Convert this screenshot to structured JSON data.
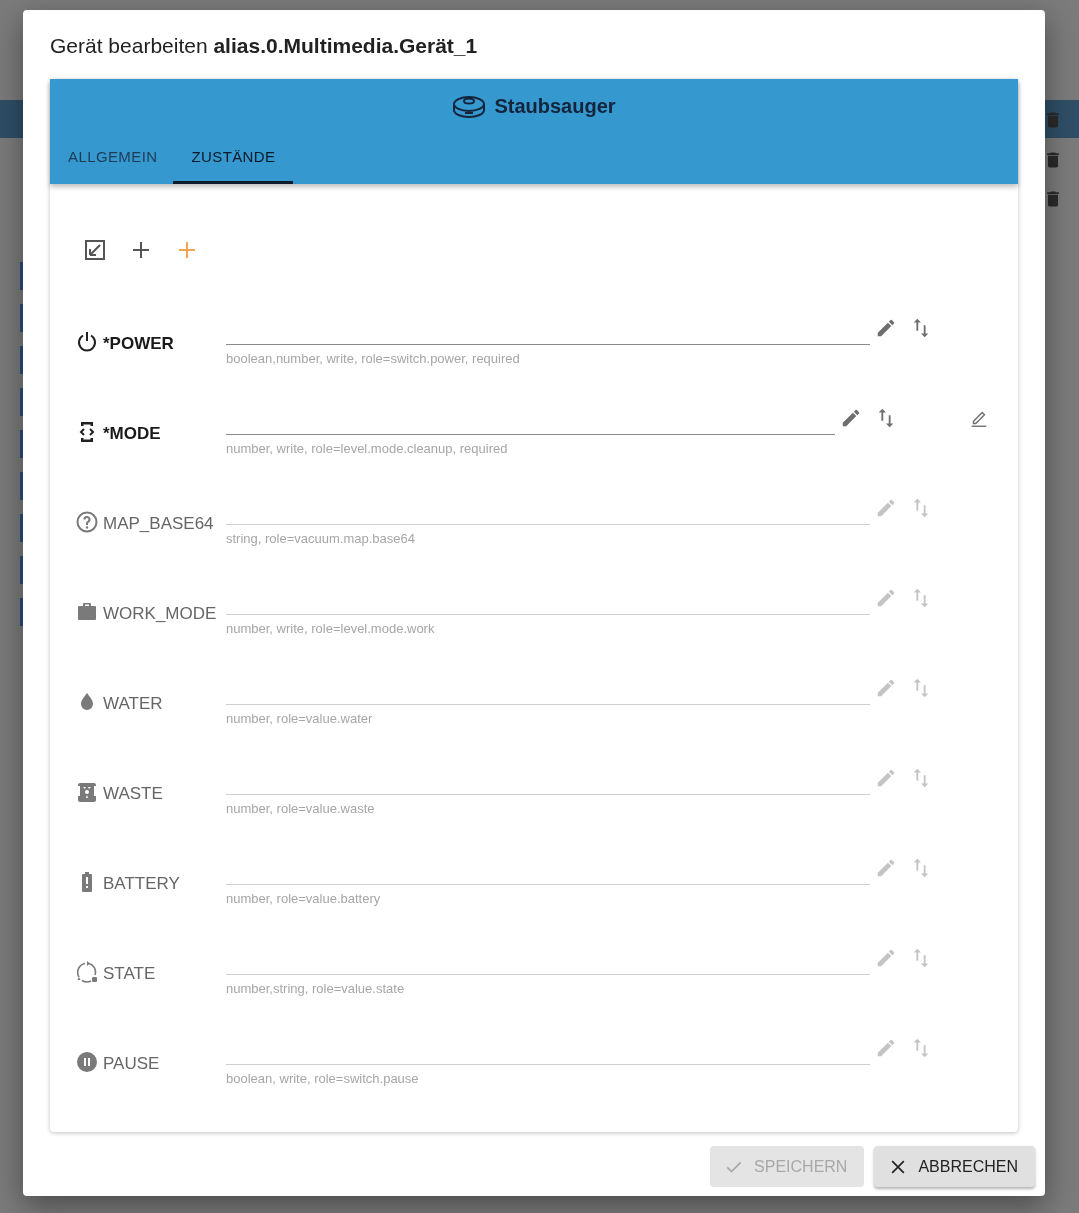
{
  "dialog": {
    "title_prefix": "Gerät bearbeiten",
    "title_id": "alias.0.Multimedia.Gerät_1"
  },
  "device": {
    "name": "Staubsauger"
  },
  "tabs": [
    {
      "label": "ALLGEMEIN",
      "selected": false
    },
    {
      "label": "ZUSTÄNDE",
      "selected": true
    }
  ],
  "states": [
    {
      "name": "*POWER",
      "required": true,
      "hint": "boolean,number, write, role=switch.power, required",
      "extra_edit": false
    },
    {
      "name": "*MODE",
      "required": true,
      "hint": "number, write, role=level.mode.cleanup, required",
      "extra_edit": true
    },
    {
      "name": "MAP_BASE64",
      "required": false,
      "hint": "string, role=vacuum.map.base64",
      "extra_edit": false
    },
    {
      "name": "WORK_MODE",
      "required": false,
      "hint": "number, write, role=level.mode.work",
      "extra_edit": false
    },
    {
      "name": "WATER",
      "required": false,
      "hint": "number, role=value.water",
      "extra_edit": false
    },
    {
      "name": "WASTE",
      "required": false,
      "hint": "number, role=value.waste",
      "extra_edit": false
    },
    {
      "name": "BATTERY",
      "required": false,
      "hint": "number, role=value.battery",
      "extra_edit": false
    },
    {
      "name": "STATE",
      "required": false,
      "hint": "number,string, role=value.state",
      "extra_edit": false
    },
    {
      "name": "PAUSE",
      "required": false,
      "hint": "boolean, write, role=switch.pause",
      "extra_edit": false
    }
  ],
  "buttons": [
    {
      "label": "SPEICHERN",
      "kind": "save",
      "disabled": true
    },
    {
      "label": "ABBRECHEN",
      "kind": "cancel",
      "disabled": false
    }
  ]
}
